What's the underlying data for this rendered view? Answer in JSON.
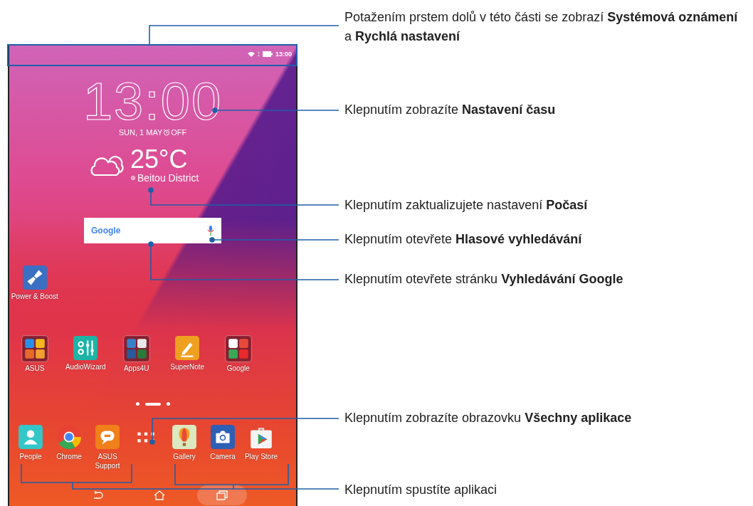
{
  "status_bar": {
    "time": "13:00"
  },
  "clock": {
    "time": "13:00",
    "date": "SUN, 1 MAY",
    "alarm": "OFF"
  },
  "weather": {
    "temperature": "25°C",
    "location": "Beitou District"
  },
  "search_bar": {
    "logo": "Google"
  },
  "desktop_apps": [
    {
      "label": "Power & Boost",
      "kind": "app"
    }
  ],
  "apps": [
    {
      "label": "ASUS",
      "kind": "folder"
    },
    {
      "label": "AudioWizard",
      "kind": "app"
    },
    {
      "label": "Apps4U",
      "kind": "folder"
    },
    {
      "label": "SuperNote",
      "kind": "app"
    },
    {
      "label": "Google",
      "kind": "folder"
    }
  ],
  "page_indicator": [
    {
      "selected": false
    },
    {
      "selected": true
    },
    {
      "selected": false
    }
  ],
  "dock": [
    {
      "label": "People",
      "kind": "app"
    },
    {
      "label": "Chrome",
      "kind": "app"
    },
    {
      "label": "ASUS Support",
      "kind": "app"
    },
    {
      "kind": "all_apps"
    },
    {
      "label": "Gallery",
      "kind": "app"
    },
    {
      "label": "Camera",
      "kind": "app"
    },
    {
      "label": "Play Store",
      "kind": "app"
    }
  ],
  "callouts": [
    "Potažením prstem dolů v této části se zobrazí **Systémová oznámení** a **Rychlá nastavení**",
    "Klepnutím zobrazíte **Nastavení času**",
    "Klepnutím zaktualizujete nastavení **Počasí**",
    "Klepnutím otevřete **Hlasové vyhledávání**",
    "Klepnutím otevřete stránku **Vyhledávání Google**",
    "Klepnutím zobrazíte obrazovku **Všechny aplikace**",
    "Klepnutím spustíte aplikaci"
  ]
}
